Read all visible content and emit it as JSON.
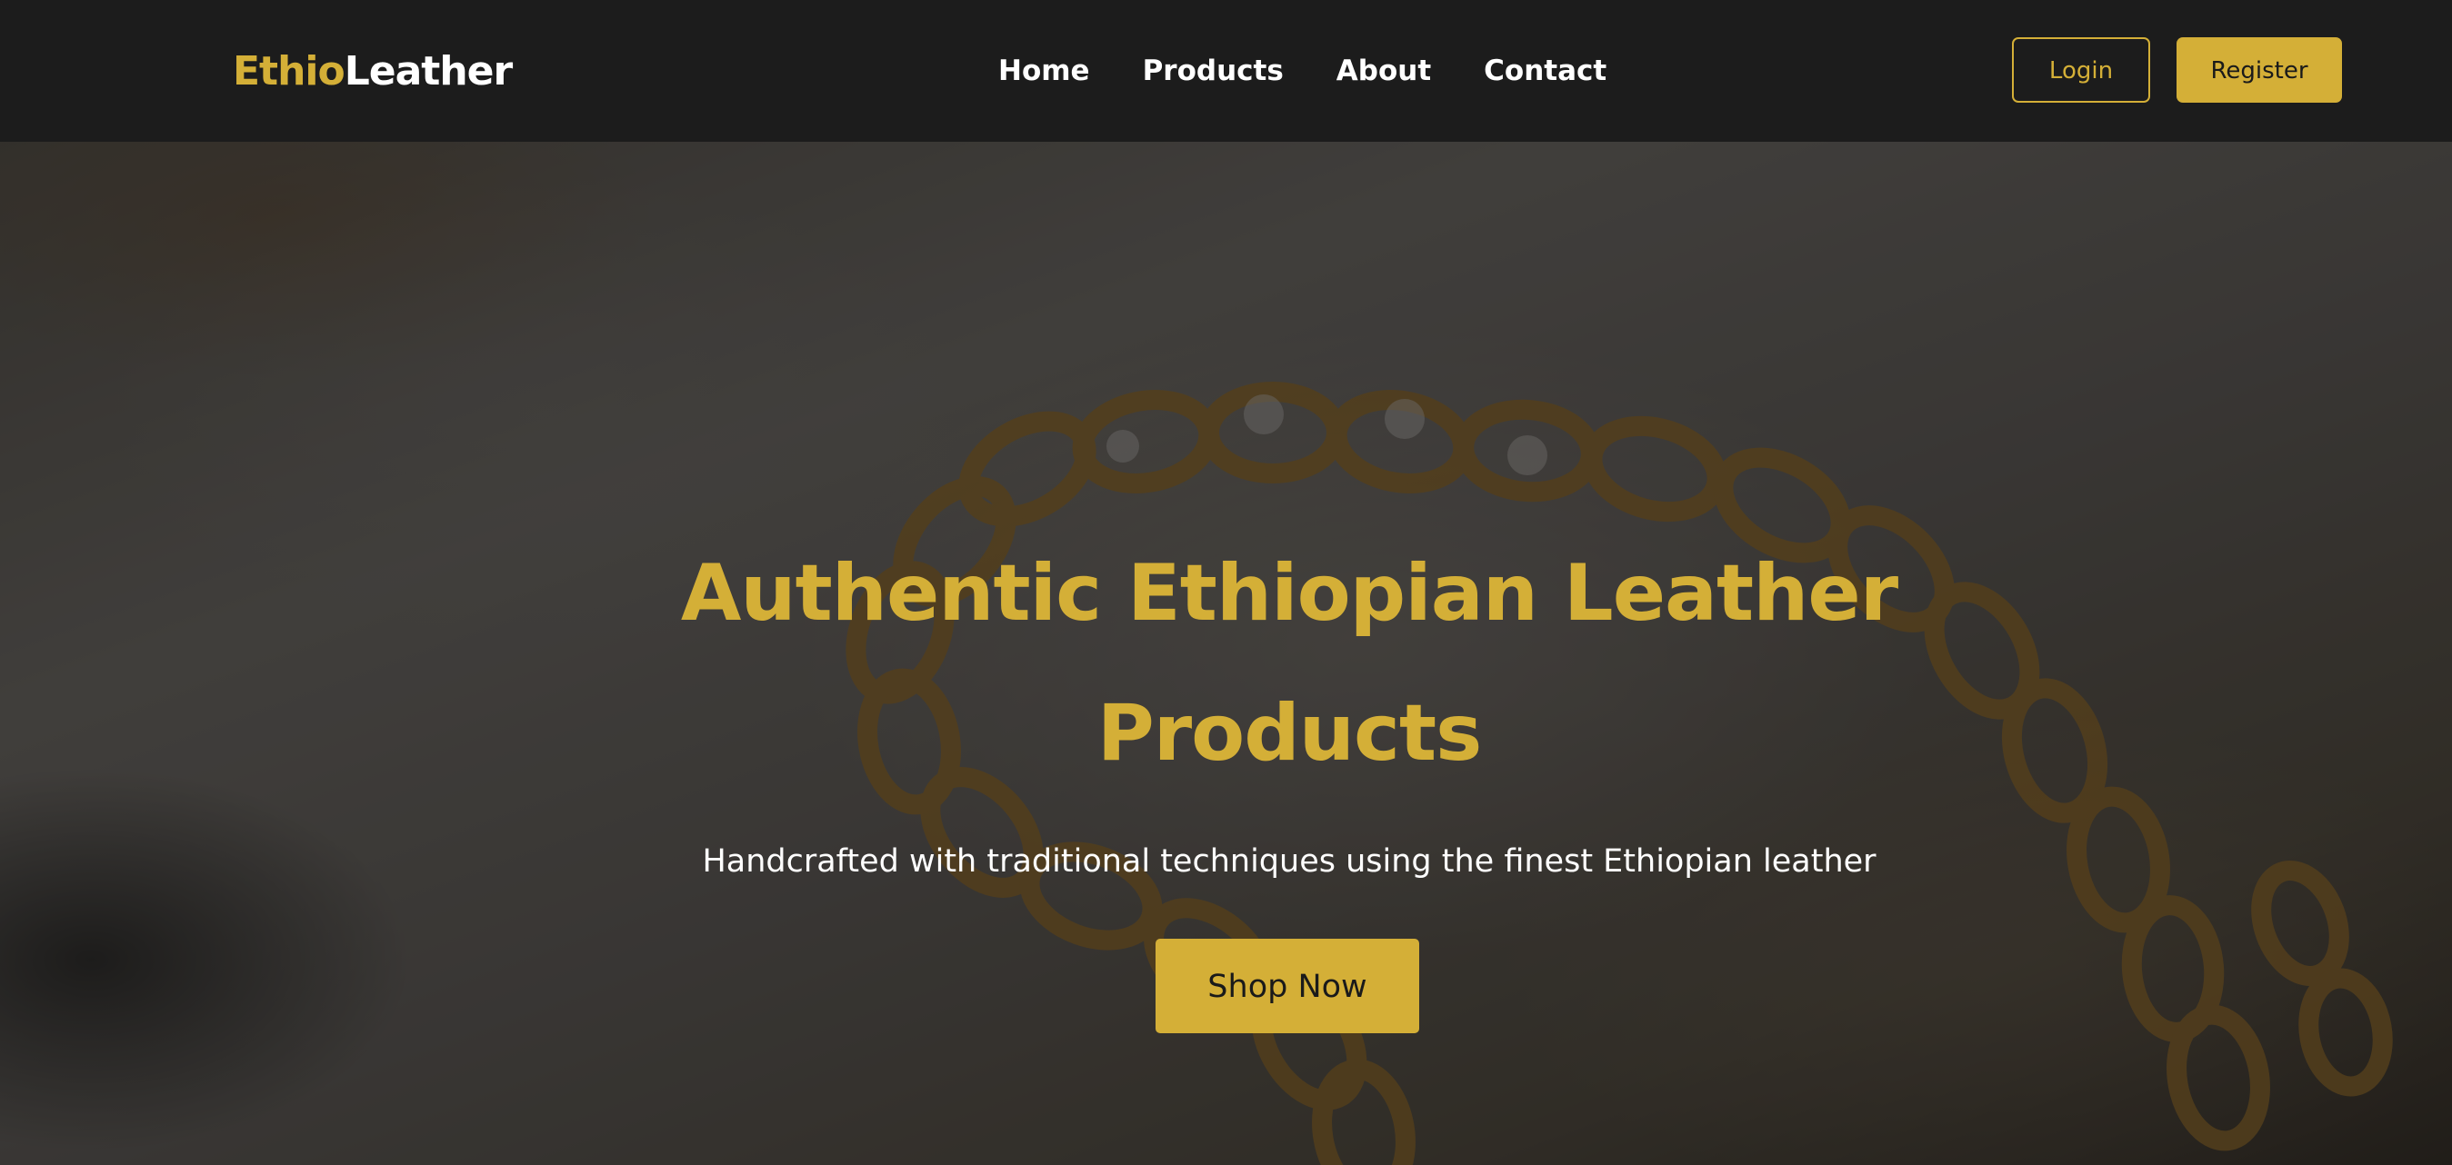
{
  "brand": {
    "logo_part1": "Ethio",
    "logo_part2": "Leather"
  },
  "nav": {
    "items": [
      {
        "label": "Home"
      },
      {
        "label": "Products"
      },
      {
        "label": "About"
      },
      {
        "label": "Contact"
      }
    ]
  },
  "auth": {
    "login_label": "Login",
    "register_label": "Register"
  },
  "hero": {
    "title": "Authentic Ethiopian Leather Products",
    "subtitle": "Handcrafted with traditional techniques using the finest Ethiopian leather",
    "cta_label": "Shop Now"
  },
  "colors": {
    "accent": "#d4af37",
    "navbar_bg": "#1c1c1c",
    "text_light": "#ffffff",
    "text_dark": "#1a1a1a"
  },
  "icons": {
    "hero_background": "gold-chain-on-leather-photo"
  }
}
